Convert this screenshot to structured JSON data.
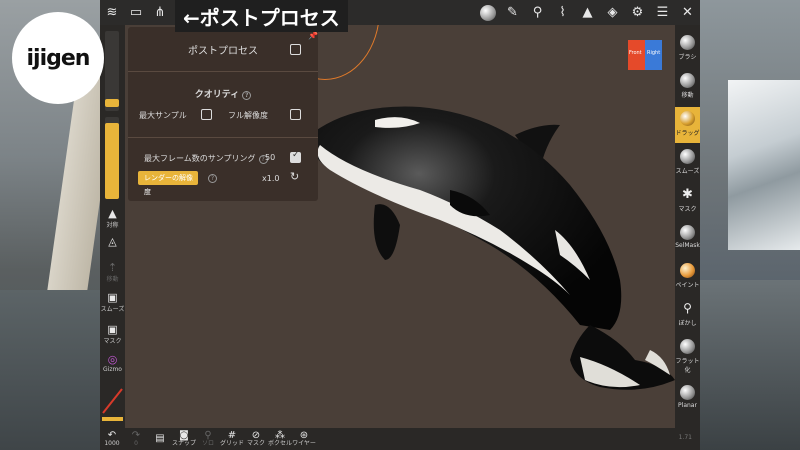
{
  "logo": {
    "text": "ijigen"
  },
  "topbar": {
    "title": "←ポストプロセス",
    "left_icons": [
      "scene-icon",
      "folder-icon",
      "share-icon",
      "sculpt-icon",
      "globe-icon",
      "sun-icon",
      "postprocess-icon"
    ],
    "right_icons": [
      "material-icon",
      "pen-icon",
      "dropper-icon",
      "topology-icon",
      "triangle-icon",
      "layers-icon",
      "gear-icon",
      "menu-icon",
      "tools-icon"
    ]
  },
  "panel": {
    "title": "ポストプロセス",
    "quality_heading": "クオリティ",
    "max_samples_label": "最大サンプル",
    "full_res_label": "フル解像度",
    "max_frame_samples_label": "最大フレーム数のサンプリング",
    "max_frame_samples_value": "50",
    "render_res_label": "レンダーの解像度",
    "render_res_value": "x1.0"
  },
  "left_toolbar": {
    "items": [
      {
        "label": "対称"
      },
      {
        "label": ""
      },
      {
        "label": "移動"
      },
      {
        "label": "スムーズ"
      },
      {
        "label": "マスク"
      },
      {
        "label": "Gizmo"
      }
    ]
  },
  "right_toolbar": {
    "items": [
      {
        "label": "ブラシ"
      },
      {
        "label": "移動"
      },
      {
        "label": "ドラッグ"
      },
      {
        "label": "スムーズ"
      },
      {
        "label": "マスク"
      },
      {
        "label": "SelMask"
      },
      {
        "label": "ペイント"
      },
      {
        "label": "ぼかし"
      },
      {
        "label": "フラット化"
      },
      {
        "label": "Planar"
      }
    ]
  },
  "bottombar": {
    "items": [
      {
        "label": "1000"
      },
      {
        "label": "0"
      },
      {
        "label": ""
      },
      {
        "label": "スナップ"
      },
      {
        "label": "ソロ"
      },
      {
        "label": "グリッド"
      },
      {
        "label": "マスク"
      },
      {
        "label": "ボクセル"
      },
      {
        "label": "ワイヤー"
      }
    ],
    "version": "1.71"
  },
  "cube": {
    "left_face": "Front",
    "right_face": "Right"
  },
  "colors": {
    "accent": "#e8b43a",
    "panel_bg": "#3a2f29",
    "toolbar_bg": "#2a2826"
  }
}
